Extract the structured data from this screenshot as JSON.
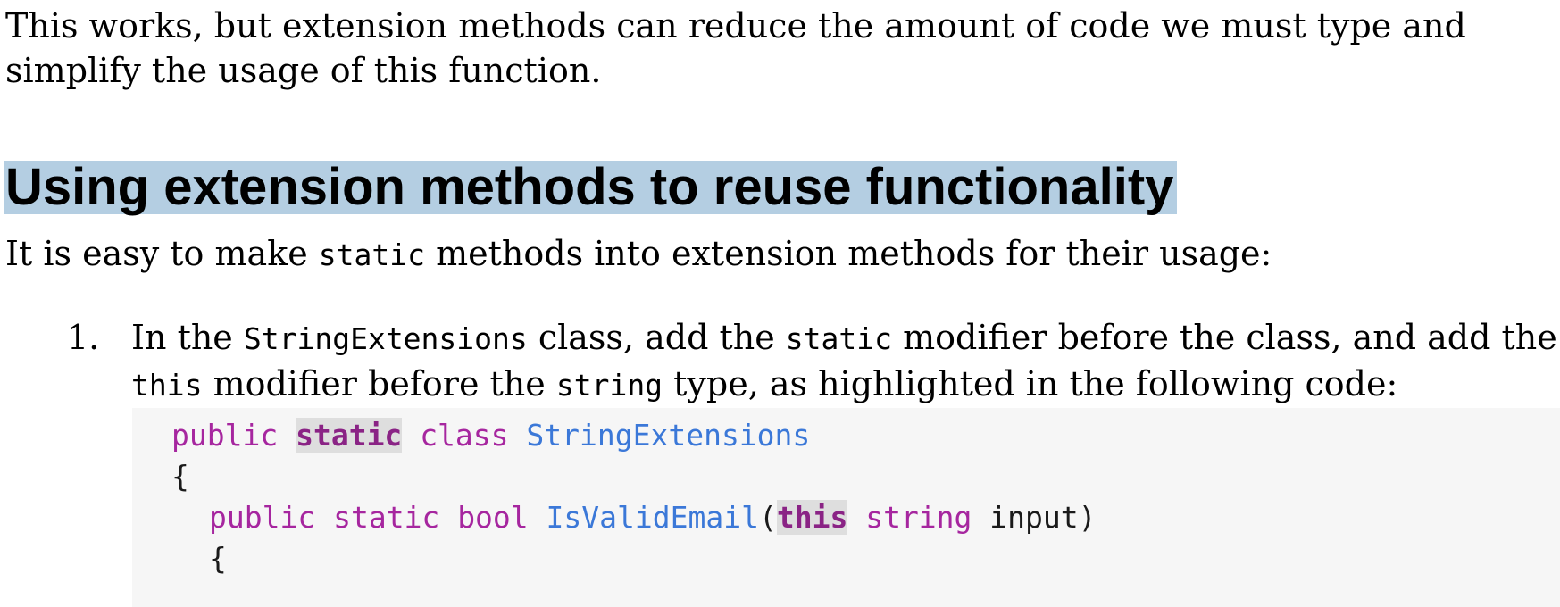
{
  "intro": {
    "text": "This works, but extension methods can reduce the amount of code we must type and simplify the usage of this function."
  },
  "heading": {
    "text": "Using extension methods to reuse functionality"
  },
  "paragraph": {
    "before": "It is easy to make ",
    "code": "static",
    "after": " methods into extension methods for their usage:"
  },
  "step": {
    "number": "1.",
    "t1": "In the ",
    "c1": "StringExtensions",
    "t2": " class, add the ",
    "c2": "static",
    "t3": " modifier before the class, and add the ",
    "c3": "this",
    "t4": " modifier before the ",
    "c4": "string",
    "t5": " type, as highlighted in the following code:"
  },
  "code": {
    "line1": {
      "kw1": "public",
      "hl": "static",
      "kw2": "class",
      "type": "StringExtensions"
    },
    "line2": {
      "brace": "{"
    },
    "line3": {
      "kw1": "public",
      "kw2": "static",
      "kw3": "bool",
      "method": "IsValidEmail",
      "paren_open": "(",
      "hl": "this",
      "kw4": "string",
      "param": "input",
      "paren_close": ")"
    },
    "line4": {
      "brace": "{"
    }
  },
  "colors": {
    "heading_highlight": "#b4cee2",
    "keyword": "#a6269f",
    "type": "#3b78d8",
    "code_background": "#f6f6f6",
    "inline_highlight": "#dedede"
  }
}
